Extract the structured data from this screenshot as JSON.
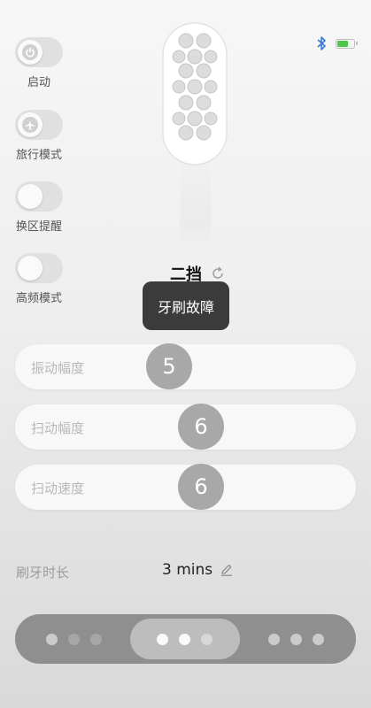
{
  "status": {
    "bluetooth_icon": "bluetooth-icon",
    "battery_icon": "battery-icon",
    "battery_level": 0.7,
    "battery_color": "#49c84a"
  },
  "toggles": [
    {
      "label": "启动",
      "icon": "power-icon",
      "on": false
    },
    {
      "label": "旅行模式",
      "icon": "airplane-icon",
      "on": false
    },
    {
      "label": "换区提醒",
      "icon": "",
      "on": false
    },
    {
      "label": "高频模式",
      "icon": "",
      "on": false
    }
  ],
  "mode": {
    "label": "二挡",
    "icon": "refresh-icon"
  },
  "tooltip": {
    "text": "牙刷故障"
  },
  "sliders": [
    {
      "label": "振动幅度",
      "value": "5"
    },
    {
      "label": "扫动幅度",
      "value": "6"
    },
    {
      "label": "扫动速度",
      "value": "6"
    }
  ],
  "duration": {
    "label": "刷牙时长",
    "value": "3 mins",
    "icon": "edit-icon"
  },
  "pager": {
    "active_page": 2,
    "total_pages": 3
  }
}
